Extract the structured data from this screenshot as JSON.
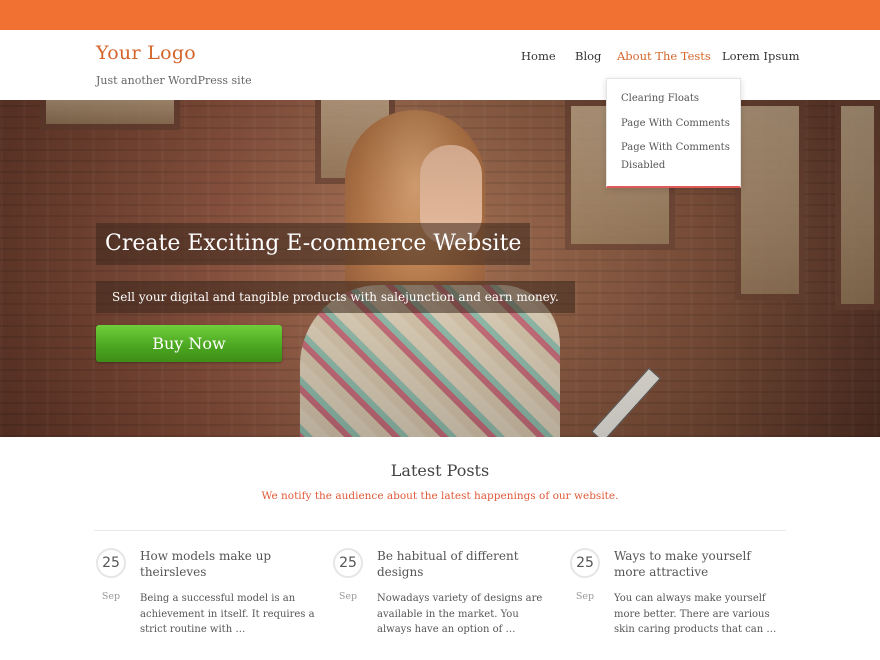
{
  "header": {
    "logo": "Your Logo",
    "tagline": "Just another WordPress site"
  },
  "nav": {
    "items": [
      {
        "label": "Home",
        "active": false
      },
      {
        "label": "Blog",
        "active": false
      },
      {
        "label": "About The Tests",
        "active": true
      },
      {
        "label": "Lorem Ipsum",
        "active": false
      }
    ],
    "dropdown": [
      {
        "label": "Clearing Floats"
      },
      {
        "label": "Page With Comments"
      },
      {
        "label": "Page With Comments Disabled"
      }
    ]
  },
  "hero": {
    "title": "Create Exciting E-commerce Website",
    "subtitle": "Sell your digital and tangible products with salejunction and earn money.",
    "button": "Buy Now"
  },
  "latest": {
    "title": "Latest Posts",
    "subtitle": "We notify the audience about the latest happenings of our website."
  },
  "posts": [
    {
      "day": "25",
      "month": "Sep",
      "title": "How models make up theirsleves",
      "excerpt": "Being a successful model is an achievement in itself. It requires a strict routine with …"
    },
    {
      "day": "25",
      "month": "Sep",
      "title": "Be habitual of different designs",
      "excerpt": "Nowadays variety of designs are available in the market. You always have an option of …"
    },
    {
      "day": "25",
      "month": "Sep",
      "title": "Ways to make yourself more attractive",
      "excerpt": "You can always make yourself more better. There are various skin caring products that can …"
    }
  ],
  "colors": {
    "topbar": "#f07132",
    "accent": "#d4652a",
    "button_green": "#4aa51f",
    "subtitle_red": "#e05a3a"
  }
}
